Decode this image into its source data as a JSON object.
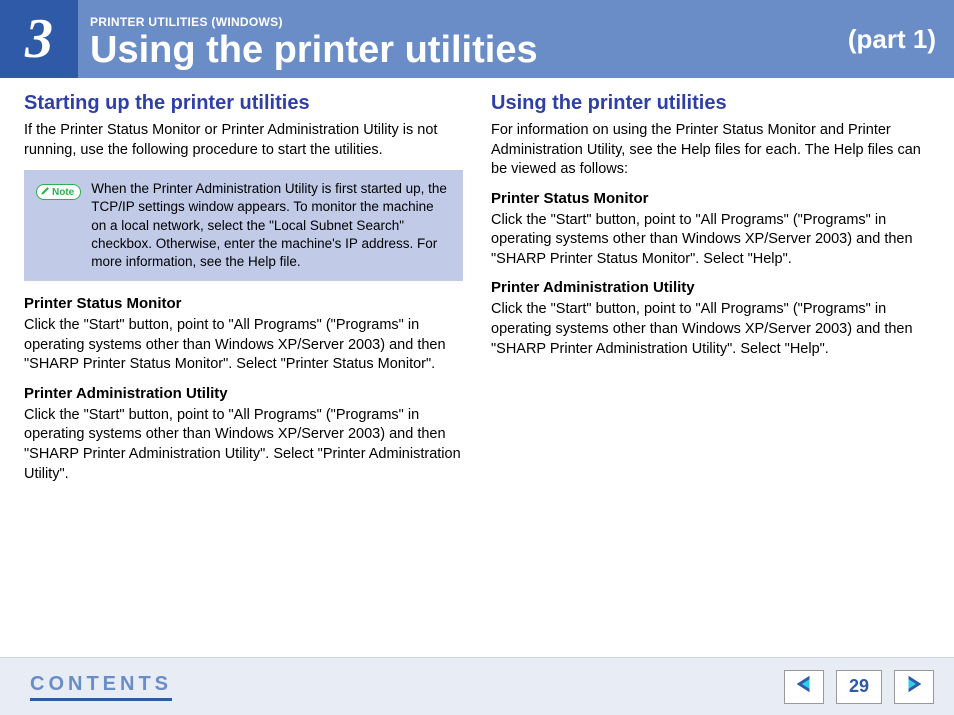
{
  "header": {
    "chapter_number": "3",
    "breadcrumb": "PRINTER UTILITIES (WINDOWS)",
    "title": "Using the printer utilities",
    "part": "(part 1)"
  },
  "left": {
    "heading": "Starting up the printer utilities",
    "intro": "If the Printer Status Monitor or Printer Administration Utility is not running, use the following procedure to start the utilities.",
    "note_label": "Note",
    "note_text": "When the Printer Administration Utility is first started up, the TCP/IP settings window appears. To monitor the machine on a local network, select the \"Local Subnet Search\" checkbox. Otherwise, enter the machine's IP address. For more information, see the Help file.",
    "sub1_title": "Printer Status Monitor",
    "sub1_body": "Click the \"Start\" button, point to \"All Programs\" (\"Programs\" in operating systems other than Windows XP/Server 2003) and then \"SHARP Printer Status Monitor\". Select \"Printer Status Monitor\".",
    "sub2_title": "Printer Administration Utility",
    "sub2_body": "Click the \"Start\" button, point to \"All Programs\" (\"Programs\" in operating systems other than Windows XP/Server 2003) and then \"SHARP Printer Administration Utility\". Select \"Printer Administration Utility\"."
  },
  "right": {
    "heading": "Using the printer utilities",
    "intro": "For information on using the Printer Status Monitor and Printer Administration Utility, see the Help files for each. The Help files can be viewed as follows:",
    "sub1_title": "Printer Status Monitor",
    "sub1_body": "Click the \"Start\" button, point to \"All Programs\" (\"Programs\" in operating systems other than Windows XP/Server 2003) and then \"SHARP Printer Status Monitor\". Select \"Help\".",
    "sub2_title": "Printer Administration Utility",
    "sub2_body": "Click the \"Start\" button, point to \"All Programs\" (\"Programs\" in operating systems other than Windows XP/Server 2003) and then \"SHARP Printer Administration Utility\". Select \"Help\"."
  },
  "footer": {
    "contents_label": "CONTENTS",
    "page_number": "29"
  }
}
